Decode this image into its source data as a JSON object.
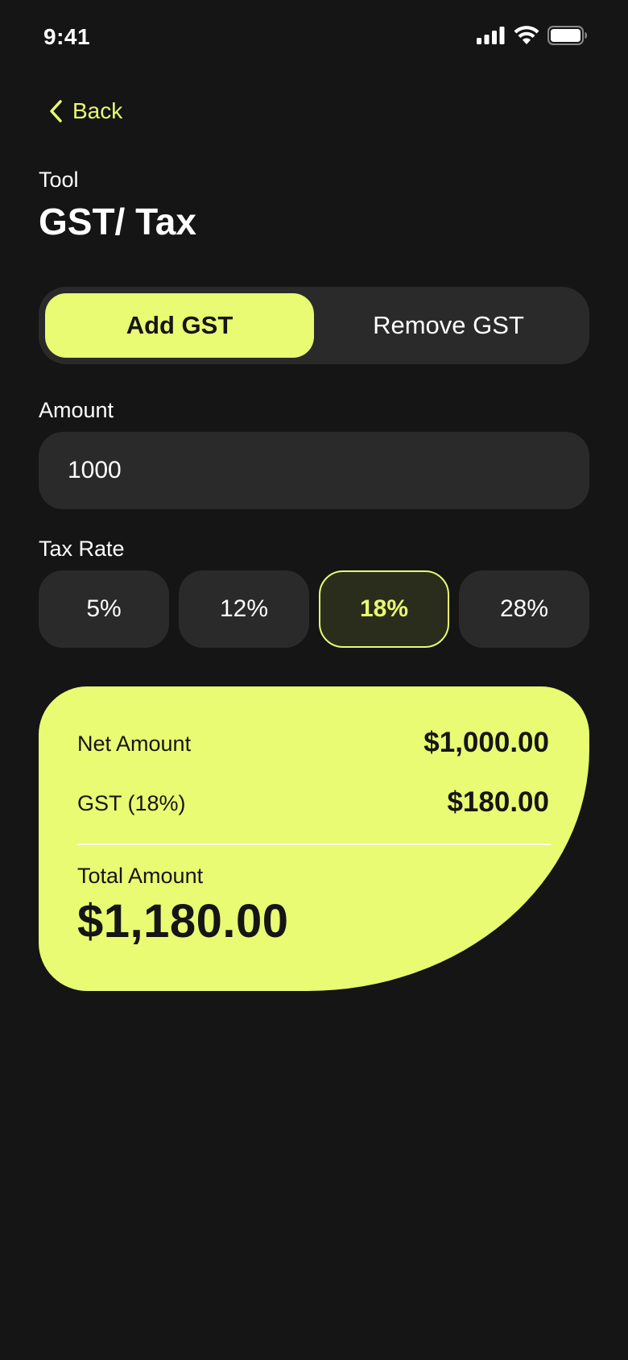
{
  "status_bar": {
    "time": "9:41"
  },
  "nav": {
    "back_label": "Back"
  },
  "header": {
    "kicker": "Tool",
    "title": "GST/ Tax"
  },
  "mode_toggle": {
    "options": [
      "Add GST",
      "Remove GST"
    ],
    "selected": "Add GST"
  },
  "amount": {
    "label": "Amount",
    "value": "1000"
  },
  "tax_rate": {
    "label": "Tax Rate",
    "options": [
      "5%",
      "12%",
      "18%",
      "28%"
    ],
    "selected": "18%"
  },
  "result": {
    "net_label": "Net Amount",
    "net_value": "$1,000.00",
    "gst_label": "GST (18%)",
    "gst_value": "$180.00",
    "total_label": "Total Amount",
    "total_value": "$1,180.00"
  },
  "colors": {
    "background": "#151515",
    "surface": "#2a2a2a",
    "accent": "#e8fb72",
    "text_on_accent": "#151515"
  }
}
